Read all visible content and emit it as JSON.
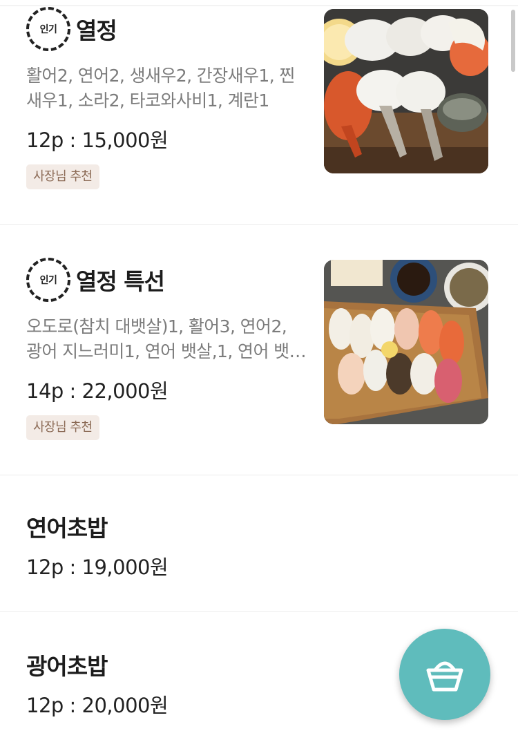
{
  "colors": {
    "accent": "#5fbcbc",
    "tag_bg": "#f3ebe6",
    "tag_text": "#8b6a55",
    "description_text": "#7c7c7c"
  },
  "menu": {
    "items": [
      {
        "badge": "인기",
        "badge_icon": "popular-badge-icon",
        "name": "열정",
        "description": "활어2, 연어2, 생새우2, 간장새우1, 찐새우1, 소라2, 타코와사비1, 계란1",
        "price": "12p : 15,000원",
        "tag": "사장님 추천",
        "image": "sushi-platter-image"
      },
      {
        "badge": "인기",
        "badge_icon": "popular-badge-icon",
        "name": "열정 특선",
        "description": "오도로(참치 대뱃살)1, 활어3, 연어2, 광어 지느러미1, 연어 뱃살,1, 연어 뱃…",
        "price": "14p : 22,000원",
        "tag": "사장님 추천",
        "image": "special-sushi-board-image"
      },
      {
        "name": "연어초밥",
        "price": "12p : 19,000원"
      },
      {
        "name": "광어초밥",
        "price": "12p : 20,000원"
      }
    ]
  },
  "cart_button": {
    "icon": "basket-icon"
  }
}
